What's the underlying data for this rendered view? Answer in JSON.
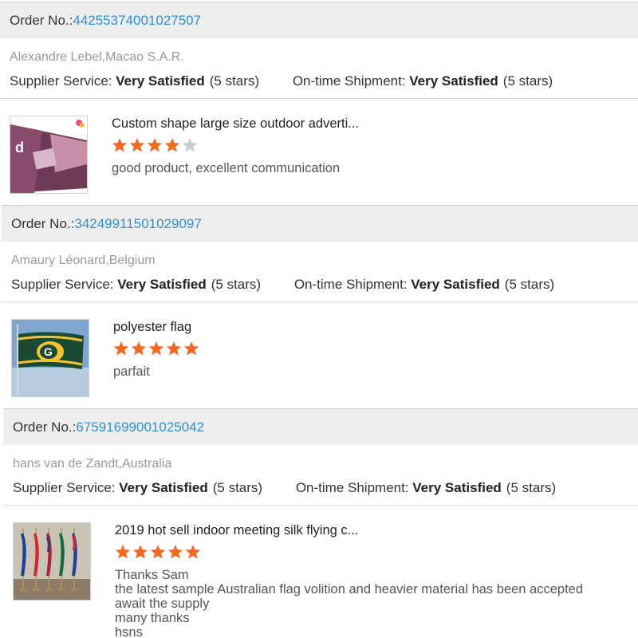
{
  "labels": {
    "order_no": "Order No.: ",
    "supplier_service": "Supplier Service: ",
    "on_time_shipment": "On-time Shipment: "
  },
  "colors": {
    "link": "#2d8fd5",
    "star_filled": "#f26a21",
    "star_empty": "#cccccc",
    "header_bg": "#eeeeee"
  },
  "orders": [
    {
      "order_number": "44255374001027507",
      "buyer": "Alexandre Lebel,Macao S.A.R.",
      "supplier_service": {
        "value": "Very Satisfied",
        "stars_text": "(5 stars)"
      },
      "shipment": {
        "value": "Very Satisfied",
        "stars_text": "(5 stars)"
      },
      "product": {
        "title": "Custom shape large size outdoor adverti...",
        "rating": 4,
        "review_lines": [
          "good product, excellent communication"
        ],
        "thumbnail_icon": "banner-photo-icon"
      }
    },
    {
      "order_number": "34249911501029097",
      "buyer": "Amaury Léonard,Belgium",
      "supplier_service": {
        "value": "Very Satisfied",
        "stars_text": "(5 stars)"
      },
      "shipment": {
        "value": "Very Satisfied",
        "stars_text": "(5 stars)"
      },
      "product": {
        "title": "polyester flag",
        "rating": 5,
        "review_lines": [
          "parfait"
        ],
        "thumbnail_icon": "flag-photo-icon"
      }
    },
    {
      "order_number": "67591699001025042",
      "buyer": "hans van de Zandt,Australia",
      "supplier_service": {
        "value": "Very Satisfied",
        "stars_text": "(5 stars)"
      },
      "shipment": {
        "value": "Very Satisfied",
        "stars_text": "(5 stars)"
      },
      "product": {
        "title": "2019 hot sell indoor meeting silk flying c...",
        "rating": 5,
        "review_lines": [
          "Thanks Sam",
          "the latest sample Australian flag volition and heavier material has been accepted",
          "await the supply",
          "many thanks",
          "hsns"
        ],
        "thumbnail_icon": "indoor-flags-photo-icon"
      }
    }
  ]
}
